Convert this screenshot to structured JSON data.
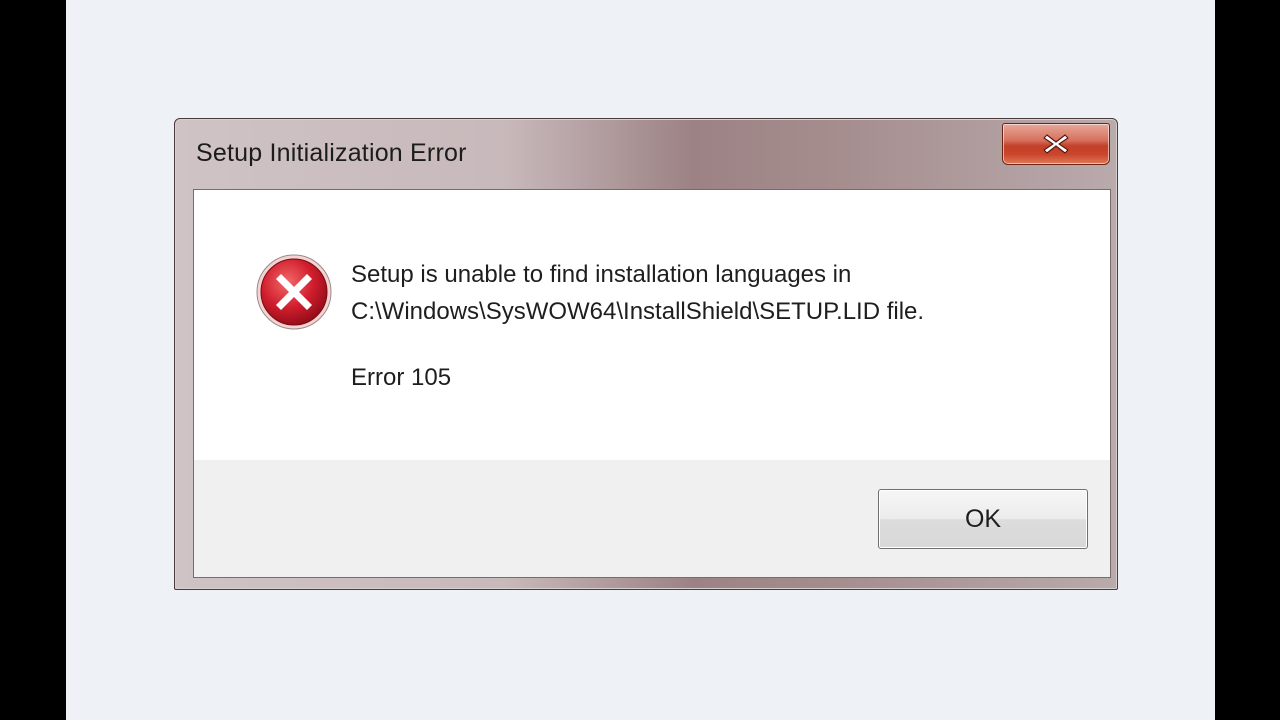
{
  "dialog": {
    "title": "Setup Initialization Error",
    "close_icon": "close-icon",
    "message_line1": "Setup is unable to find installation languages in",
    "message_line2": "C:\\Windows\\SysWOW64\\InstallShield\\SETUP.LID file.",
    "error_code": "Error 105",
    "error_icon": "error-icon",
    "ok_label": "OK"
  },
  "colors": {
    "close_button": "#c9442b",
    "error_icon_red": "#c8102e",
    "page_background": "#eef1f6"
  }
}
